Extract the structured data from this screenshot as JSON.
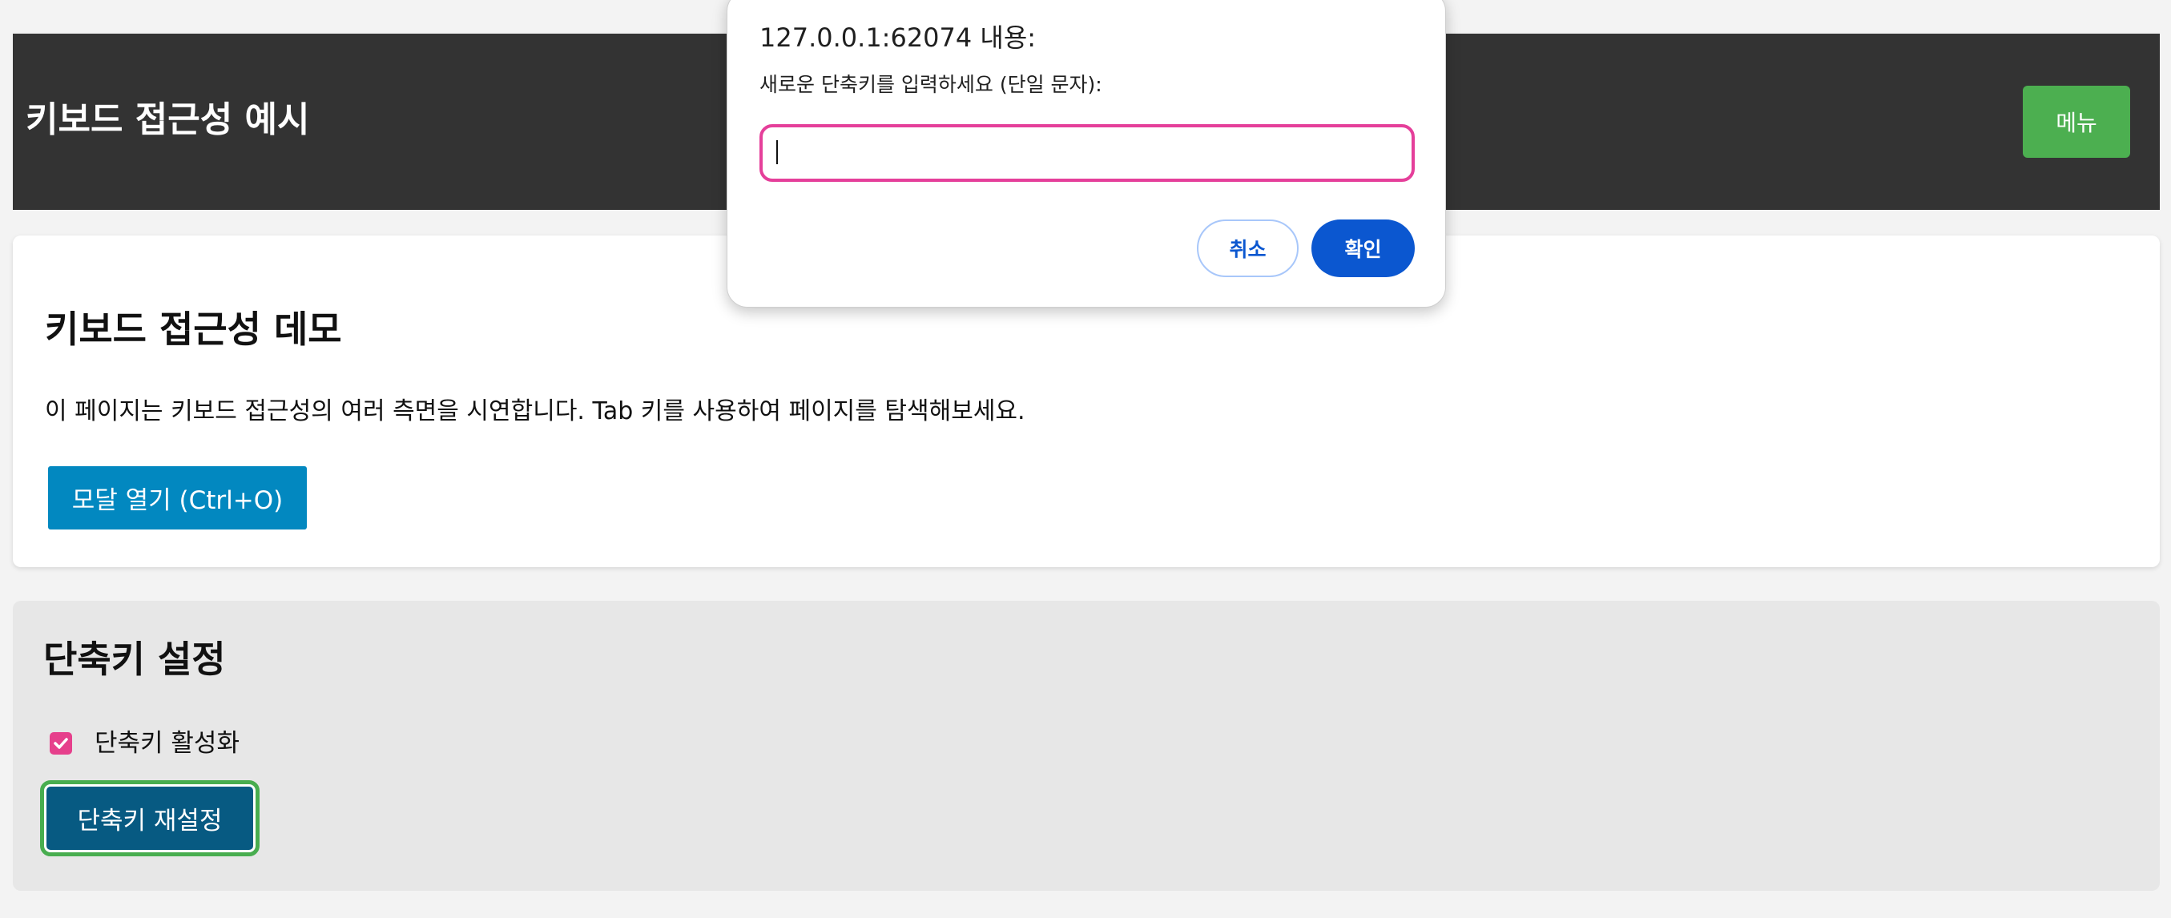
{
  "header": {
    "title": "키보드 접근성 예시",
    "menu_label": "메뉴"
  },
  "demo": {
    "heading": "키보드 접근성 데모",
    "description": "이 페이지는 키보드 접근성의 여러 측면을 시연합니다. Tab 키를 사용하여 페이지를 탐색해보세요.",
    "modal_button_label": "모달 열기 (Ctrl+O)"
  },
  "shortcut_settings": {
    "heading": "단축키 설정",
    "enable_label": "단축키 활성화",
    "enable_checked": true,
    "reset_label": "단축키 재설정"
  },
  "dialog": {
    "title": "127.0.0.1:62074 내용:",
    "message": "새로운 단축키를 입력하세요 (단일 문자):",
    "input_value": "",
    "cancel_label": "취소",
    "ok_label": "확인"
  },
  "colors": {
    "header_bg": "#333333",
    "menu_button": "#4caf50",
    "modal_button": "#0288c0",
    "reset_button": "#075a82",
    "focus_ring": "#48ad4f",
    "checkbox": "#e6408c",
    "dialog_primary": "#0b57d0",
    "input_focus": "#e53f9a"
  }
}
